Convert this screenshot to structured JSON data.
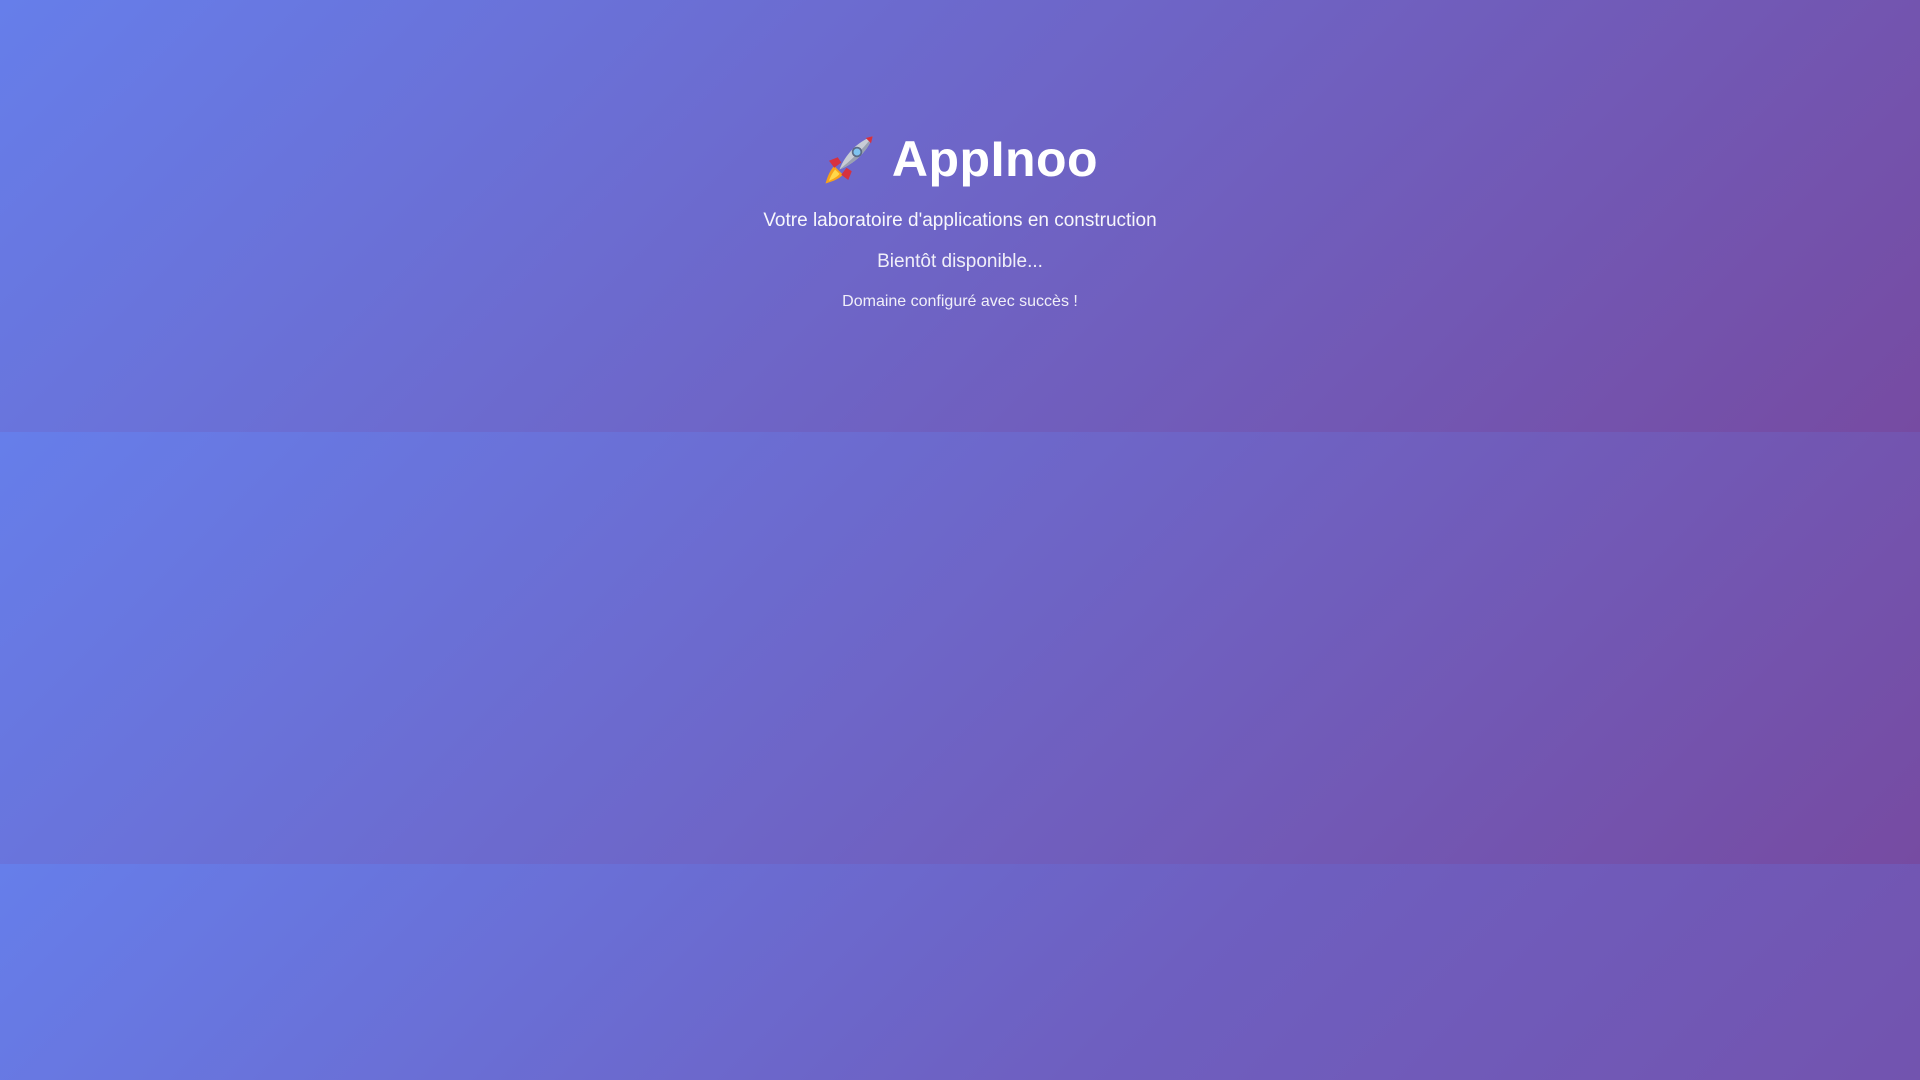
{
  "brand": {
    "icon": "rocket-icon",
    "name": "AppInoo"
  },
  "tagline": "Votre laboratoire d'applications en construction",
  "announcement": "Bientôt disponible...",
  "status": "Domaine configuré avec succès !",
  "colors": {
    "gradient_start": "#667eea",
    "gradient_end": "#764ba2",
    "text": "#ffffff"
  }
}
